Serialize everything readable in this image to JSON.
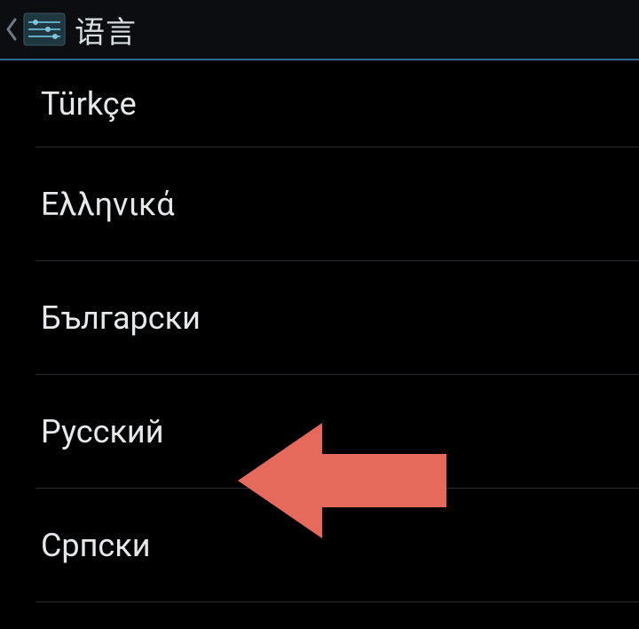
{
  "header": {
    "title": "语言"
  },
  "languages": {
    "items": [
      {
        "label": "Türkçe"
      },
      {
        "label": "Ελληνικά"
      },
      {
        "label": "Български"
      },
      {
        "label": "Русский"
      },
      {
        "label": "Српски"
      }
    ]
  },
  "annotation": {
    "highlight_index": 3,
    "color": "#e66a5c"
  }
}
